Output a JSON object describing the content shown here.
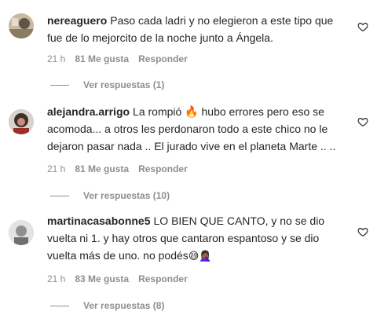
{
  "comments": [
    {
      "username": "nereaguero",
      "text": "Paso cada ladri y no elegieron a este tipo que fue de lo mejorcito de la noche junto a Ángela.",
      "emoji": "",
      "time": "21 h",
      "likes": "81 Me gusta",
      "reply_label": "Responder",
      "view_replies": "Ver respuestas (1)",
      "avatar_color": "#c9b9a3"
    },
    {
      "username": "alejandra.arrigo",
      "text": "La rompió 🔥 hubo errores pero eso se acomoda... a otros les perdonaron todo a este chico no le dejaron pasar nada .. El jurado vive en el planeta Marte .. ..",
      "emoji": "",
      "time": "21 h",
      "likes": "81 Me gusta",
      "reply_label": "Responder",
      "view_replies": "Ver respuestas (10)",
      "avatar_color": "#6b5a52"
    },
    {
      "username": "martinacasabonne5",
      "text": "LO BIEN QUE CANTO, y no se dio vuelta ni 1. y hay otros que cantaron espantoso y se dio vuelta más de uno. no podés",
      "emoji": "😅🤦🏾‍♀️",
      "time": "21 h",
      "likes": "83 Me gusta",
      "reply_label": "Responder",
      "view_replies": "Ver respuestas (8)",
      "avatar_color": "#bdbdbd"
    }
  ],
  "icons": {
    "like": "heart-outline-icon"
  }
}
